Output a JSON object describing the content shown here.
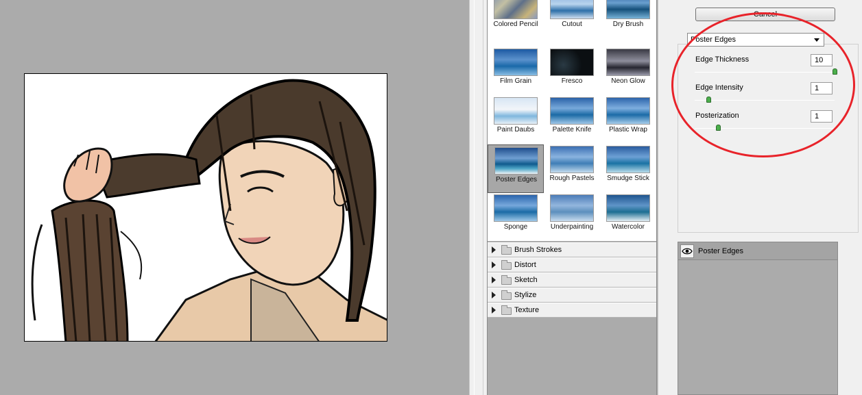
{
  "gallery": {
    "thumbnails": [
      {
        "label": "Colored Pencil"
      },
      {
        "label": "Cutout"
      },
      {
        "label": "Dry Brush"
      },
      {
        "label": "Film Grain"
      },
      {
        "label": "Fresco"
      },
      {
        "label": "Neon Glow"
      },
      {
        "label": "Paint Daubs"
      },
      {
        "label": "Palette Knife"
      },
      {
        "label": "Plastic Wrap"
      },
      {
        "label": "Poster Edges"
      },
      {
        "label": "Rough Pastels"
      },
      {
        "label": "Smudge Stick"
      },
      {
        "label": "Sponge"
      },
      {
        "label": "Underpainting"
      },
      {
        "label": "Watercolor"
      }
    ],
    "selected": "Poster Edges",
    "categories": [
      {
        "label": "Brush Strokes"
      },
      {
        "label": "Distort"
      },
      {
        "label": "Sketch"
      },
      {
        "label": "Stylize"
      },
      {
        "label": "Texture"
      }
    ]
  },
  "settings": {
    "cancel_label": "Cancel",
    "filter_name": "Poster Edges",
    "params": [
      {
        "label": "Edge Thickness",
        "value": "10",
        "min": 0,
        "max": 10
      },
      {
        "label": "Edge Intensity",
        "value": "1",
        "min": 0,
        "max": 10
      },
      {
        "label": "Posterization",
        "value": "1",
        "min": 0,
        "max": 6
      }
    ]
  },
  "layers": {
    "items": [
      {
        "label": "Poster Edges",
        "visible": true
      }
    ]
  },
  "colors": {
    "highlight_ring": "#e8232a",
    "slider_knob": "#4caf4c"
  }
}
